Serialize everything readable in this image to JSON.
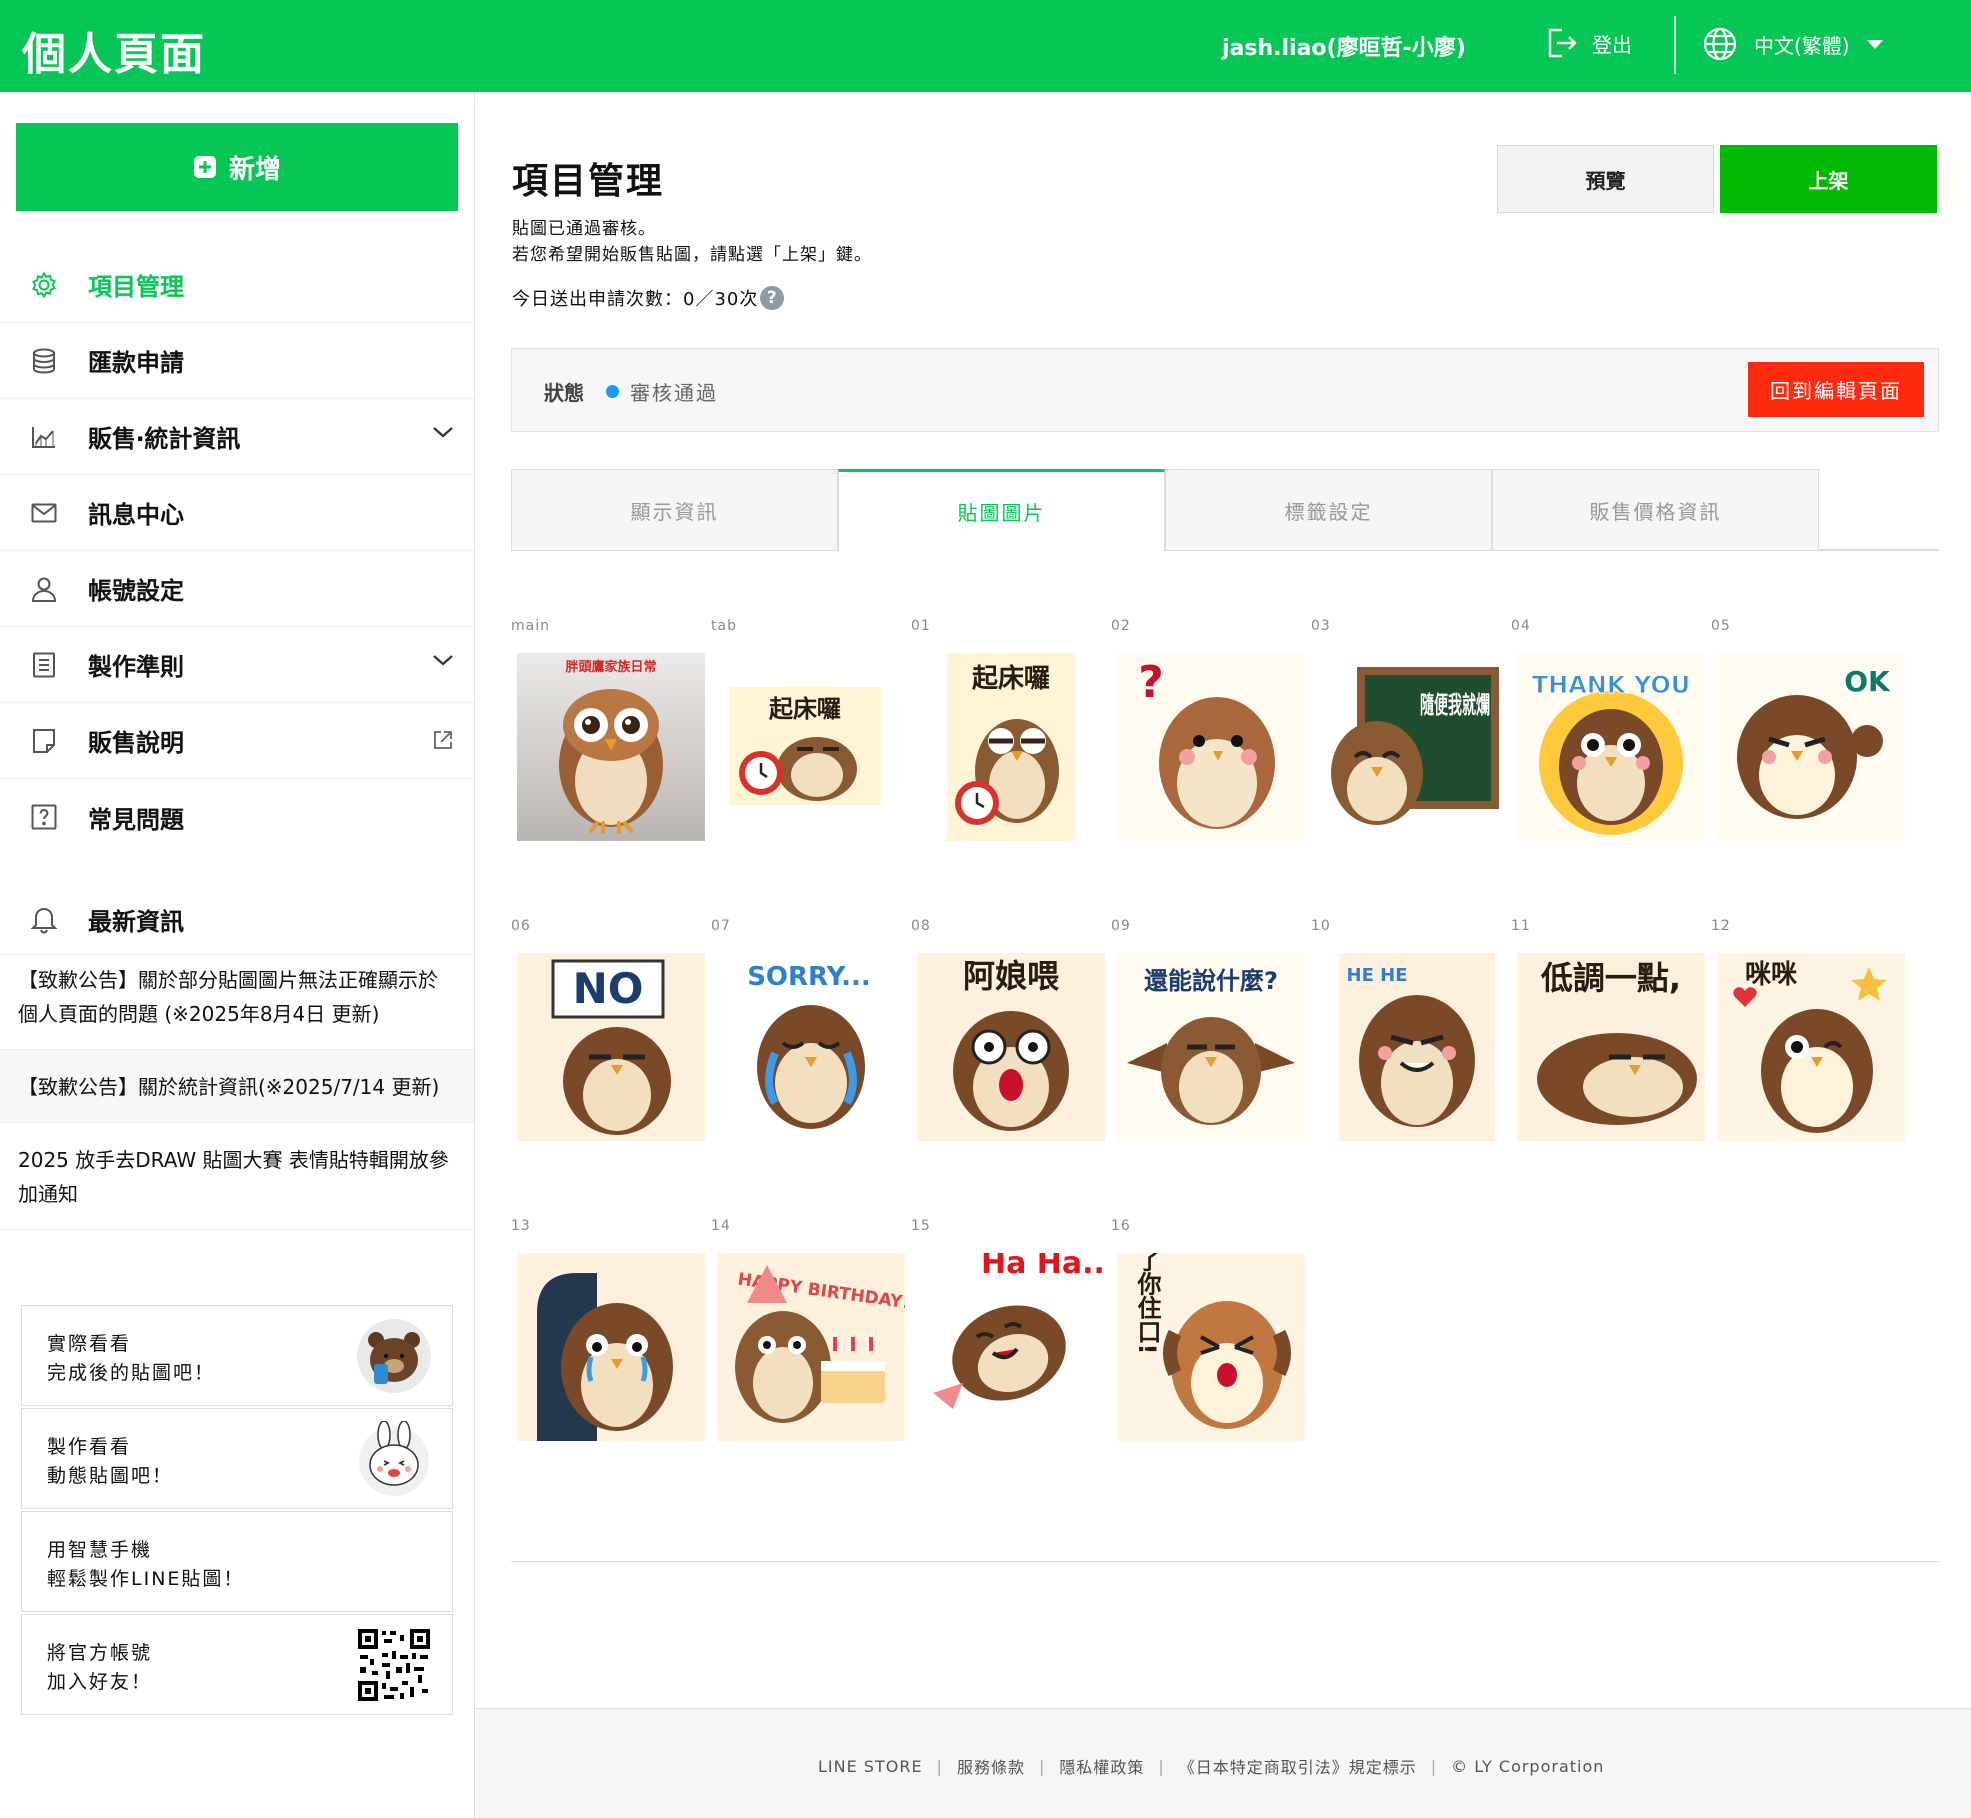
{
  "header": {
    "title": "個人頁面",
    "user": "jash.liao(廖晅哲-小廖)",
    "logout_label": "登出",
    "language_label": "中文(繁體)",
    "brand_color": "#06c755"
  },
  "sidebar": {
    "add_label": "新增",
    "nav": [
      {
        "label": "項目管理",
        "icon": "gear-icon",
        "active": true
      },
      {
        "label": "匯款申請",
        "icon": "coins-icon"
      },
      {
        "label": "販售‧統計資訊",
        "icon": "chart-icon",
        "expandable": true
      },
      {
        "label": "訊息中心",
        "icon": "mail-icon"
      },
      {
        "label": "帳號設定",
        "icon": "user-icon"
      },
      {
        "label": "製作準則",
        "icon": "document-icon",
        "expandable": true
      },
      {
        "label": "販售說明",
        "icon": "note-icon",
        "external": true
      },
      {
        "label": "常見問題",
        "icon": "question-icon"
      }
    ],
    "news_title": "最新資訊",
    "news": [
      "【致歉公告】關於部分貼圖圖片無法正確顯示於個人頁面的問題 (※2025年8月4日 更新)",
      "【致歉公告】關於統計資訊(※2025/7/14 更新)",
      "2025 放手去DRAW 貼圖大賽 表情貼特輯開放參加通知"
    ],
    "promos": [
      {
        "line1": "實際看看",
        "line2": "完成後的貼圖吧！"
      },
      {
        "line1": "製作看看",
        "line2": "動態貼圖吧！"
      },
      {
        "line1": "用智慧手機",
        "line2": "輕鬆製作LINE貼圖！"
      },
      {
        "line1": "將官方帳號",
        "line2": "加入好友！"
      }
    ]
  },
  "main": {
    "title": "項目管理",
    "desc_line1": "貼圖已通過審核。",
    "desc_line2": "若您希望開始販售貼圖，請點選「上架」鍵。",
    "count_text": "今日送出申請次數：0／30次",
    "preview_label": "預覽",
    "publish_label": "上架",
    "status_label": "狀態",
    "status_value": "審核通過",
    "back_label": "回到編輯頁面",
    "tabs": [
      "顯示資訊",
      "貼圖圖片",
      "標籤設定",
      "販售價格資訊"
    ],
    "active_tab": "貼圖圖片",
    "stickers": [
      {
        "label": "main",
        "text": "胖頭鷹家族日常"
      },
      {
        "label": "tab",
        "text": "起床囉"
      },
      {
        "label": "01",
        "text": "起床囉"
      },
      {
        "label": "02",
        "text": "?"
      },
      {
        "label": "03",
        "text": "隨便我就爛"
      },
      {
        "label": "04",
        "text": "THANK YOU"
      },
      {
        "label": "05",
        "text": "OK"
      },
      {
        "label": "06",
        "text": "NO"
      },
      {
        "label": "07",
        "text": "SORRY..."
      },
      {
        "label": "08",
        "text": "阿娘喂"
      },
      {
        "label": "09",
        "text": "還能說什麼?"
      },
      {
        "label": "10",
        "text": "HE HE"
      },
      {
        "label": "11",
        "text": "低調一點,"
      },
      {
        "label": "12",
        "text": "咪咪"
      },
      {
        "label": "13",
        "text": ""
      },
      {
        "label": "14",
        "text": "HAPPY BIRTHDAY!!"
      },
      {
        "label": "15",
        "text": "Ha Ha.."
      },
      {
        "label": "16",
        "text": "夠了你住口!"
      }
    ]
  },
  "footer": {
    "links": [
      "LINE STORE",
      "服務條款",
      "隱私權政策",
      "《日本特定商取引法》規定標示",
      "© LY Corporation"
    ]
  },
  "colors": {
    "status_dot": "#1a9bf0",
    "back_button": "#ff2b11",
    "publish_button": "#00b900"
  }
}
